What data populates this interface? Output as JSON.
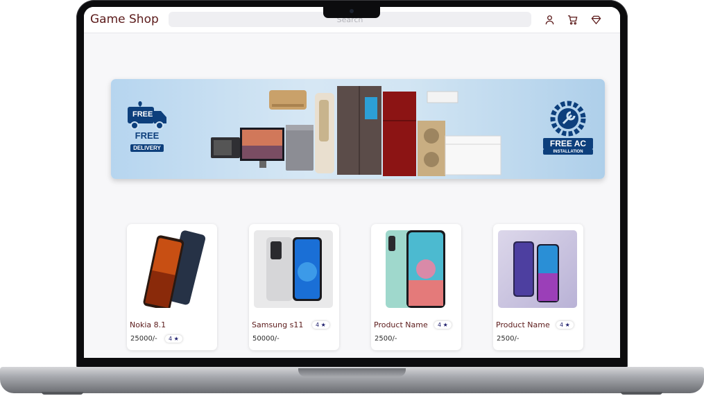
{
  "app": {
    "title": "Game Shop",
    "search_placeholder": "Search"
  },
  "header_icons": [
    "user-icon",
    "cart-icon",
    "wishlist-icon"
  ],
  "banner": {
    "left_badge": {
      "top": "FREE",
      "bottom": "FREE",
      "sub": "DELIVERY"
    },
    "right_badge": {
      "title": "FREE AC",
      "sub": "INSTALLATION"
    }
  },
  "products": [
    {
      "name": "Nokia 8.1",
      "rating": "4",
      "price": "25000/-"
    },
    {
      "name": "Samsung s11",
      "rating": "4",
      "price": "50000/-"
    },
    {
      "name": "Product Name",
      "rating": "4",
      "price": "2500/-"
    },
    {
      "name": "Product Name",
      "rating": "4",
      "price": "2500/-"
    }
  ],
  "colors": {
    "brand": "#5b1a1a",
    "badge": "#0d3f7c",
    "rating": "#1b1b6a"
  }
}
